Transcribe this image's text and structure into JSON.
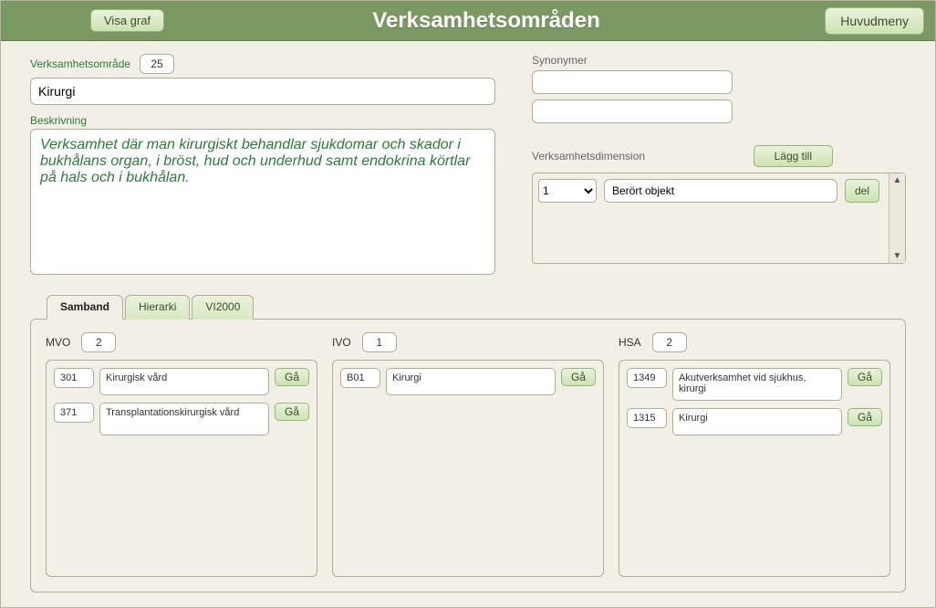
{
  "header": {
    "title": "Verksamhetsområden",
    "show_graph_label": "Visa graf",
    "main_menu_label": "Huvudmeny"
  },
  "area": {
    "label": "Verksamhetsområde",
    "id": "25",
    "name": "Kirurgi",
    "description_label": "Beskrivning",
    "description": "Verksamhet där man kirurgiskt behandlar sjukdomar och skador i bukhålans organ, i bröst, hud och underhud samt endokrina körtlar på hals och i bukhålan."
  },
  "synonyms": {
    "label": "Synonymer",
    "value1": "",
    "value2": ""
  },
  "dimension": {
    "label": "Verksamhetsdimension",
    "add_label": "Lägg till",
    "del_label": "del",
    "select_value": "1",
    "text_value": "Berört objekt",
    "scroll_up": "▲",
    "scroll_down": "▼"
  },
  "tabs": {
    "samband": "Samband",
    "hierarki": "Hierarki",
    "vi2000": "VI2000"
  },
  "go_label": "Gå",
  "mvo": {
    "label": "MVO",
    "count": "2",
    "items": [
      {
        "code": "301",
        "name": "Kirurgisk vård"
      },
      {
        "code": "371",
        "name": "Transplantationskirurgisk vård"
      }
    ]
  },
  "ivo": {
    "label": "IVO",
    "count": "1",
    "items": [
      {
        "code": "B01",
        "name": "Kirurgi"
      }
    ]
  },
  "hsa": {
    "label": "HSA",
    "count": "2",
    "items": [
      {
        "code": "1349",
        "name": "Akutverksamhet vid sjukhus, kirurgi"
      },
      {
        "code": "1315",
        "name": "Kirurgi"
      }
    ]
  }
}
